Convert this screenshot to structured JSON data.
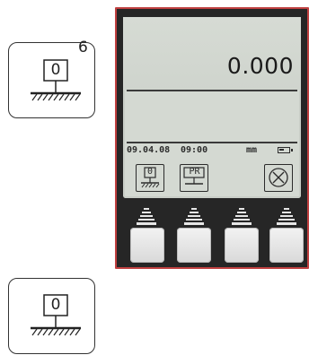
{
  "legend": {
    "icon_top": {
      "symbol": "zero-reference-icon",
      "label": "0",
      "footnote": "6"
    },
    "icon_bottom": {
      "symbol": "zero-reference-icon",
      "label": "0"
    }
  },
  "device": {
    "display": {
      "reading": "0.000",
      "status": {
        "date": "09.04.08",
        "time": "09:00",
        "unit": "mm",
        "battery_icon": "battery-icon",
        "battery_level": 0.5
      },
      "softkeys": [
        {
          "icon": "zero-reference-icon",
          "label": "0"
        },
        {
          "icon": "preset-reference-icon",
          "label": "PR"
        },
        {
          "icon": "empty-slot",
          "label": ""
        },
        {
          "icon": "cancel-circle-icon",
          "label": ""
        }
      ]
    },
    "buttons": [
      {
        "arrow_icon": "up-arrow-icon"
      },
      {
        "arrow_icon": "up-arrow-icon"
      },
      {
        "arrow_icon": "up-arrow-icon"
      },
      {
        "arrow_icon": "up-arrow-icon"
      }
    ],
    "colors": {
      "housing": "#262626",
      "accent": "#c04040",
      "lcd": "#d4d9d2",
      "lcd_ink": "#2b2b2b"
    }
  }
}
